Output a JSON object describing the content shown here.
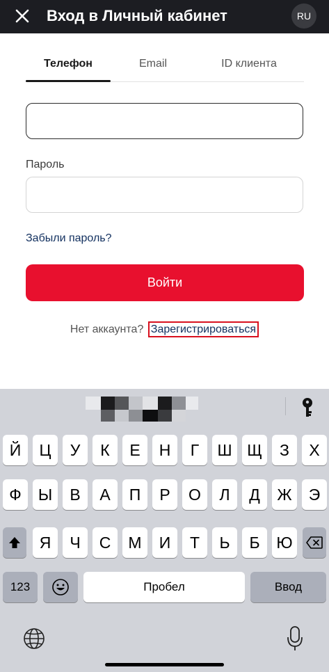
{
  "header": {
    "title": "Вход в Личный кабинет",
    "lang": "RU",
    "close_icon": "close-icon"
  },
  "tabs": [
    {
      "label": "Телефон",
      "active": true
    },
    {
      "label": "Email",
      "active": false
    },
    {
      "label": "ID клиента",
      "active": false
    }
  ],
  "form": {
    "phone_value": "",
    "password_label": "Пароль",
    "password_value": "",
    "forgot_label": "Забыли пароль?",
    "login_label": "Войти",
    "no_account": "Нет аккаунта?",
    "register_label": "Зарегистрироваться"
  },
  "keyboard": {
    "row1": [
      "Й",
      "Ц",
      "У",
      "К",
      "Е",
      "Н",
      "Г",
      "Ш",
      "Щ",
      "З",
      "Х"
    ],
    "row2": [
      "Ф",
      "Ы",
      "В",
      "А",
      "П",
      "Р",
      "О",
      "Л",
      "Д",
      "Ж",
      "Э"
    ],
    "row3": [
      "Я",
      "Ч",
      "С",
      "М",
      "И",
      "Т",
      "Ь",
      "Б",
      "Ю"
    ],
    "numbers_label": "123",
    "space_label": "Пробел",
    "enter_label": "Ввод"
  },
  "colors": {
    "header_bg": "#1c1d22",
    "accent_red": "#e8102e",
    "link_blue": "#12305f",
    "highlight_border": "#d8101e",
    "keyboard_bg": "#d1d3d9"
  }
}
